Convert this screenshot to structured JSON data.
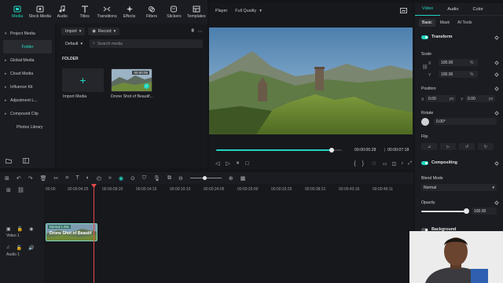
{
  "toolbar": {
    "items": [
      {
        "label": "Media",
        "icon": "media-icon"
      },
      {
        "label": "Stock Media",
        "icon": "cloud-icon"
      },
      {
        "label": "Audio",
        "icon": "music-icon"
      },
      {
        "label": "Titles",
        "icon": "text-icon"
      },
      {
        "label": "Transitions",
        "icon": "transition-icon"
      },
      {
        "label": "Effects",
        "icon": "sparkle-icon"
      },
      {
        "label": "Filters",
        "icon": "filter-icon"
      },
      {
        "label": "Stickers",
        "icon": "sticker-icon"
      },
      {
        "label": "Templates",
        "icon": "template-icon"
      }
    ],
    "active_color": "#1fd6c1"
  },
  "sidebar": {
    "items": [
      {
        "label": "Project Media"
      },
      {
        "label": "Folder"
      },
      {
        "label": "Global Media"
      },
      {
        "label": "Cloud Media"
      },
      {
        "label": "Influence Kit"
      },
      {
        "label": "Adjustment L..."
      },
      {
        "label": "Compound Clip"
      },
      {
        "label": "Photos Library"
      }
    ]
  },
  "media": {
    "import_label": "Import",
    "record_label": "Record",
    "sort_label": "Default",
    "search_placeholder": "Search media",
    "folder_heading": "FOLDER",
    "import_tile_label": "Import Media",
    "clip_label": "Drone Shot of Beautif...",
    "clip_duration": "00:00:05"
  },
  "player": {
    "label": "Player",
    "quality": "Full Quality",
    "current_time": "00:00:06:28",
    "total_time": "00:00:07:18",
    "progress": 0.92
  },
  "right_panel": {
    "tabs": [
      "Video",
      "Audio",
      "Color"
    ],
    "subtabs": [
      "Basic",
      "Mask",
      "AI Tools"
    ],
    "transform_label": "Transform",
    "scale_label": "Scale",
    "scale_x_label": "X",
    "scale_x": "100.00",
    "scale_y_label": "Y",
    "scale_y": "100.00",
    "percent_unit": "%",
    "position_label": "Position",
    "pos_x_label": "X",
    "pos_x": "0.00",
    "pos_y_label": "Y",
    "pos_y": "0.00",
    "px_unit": "px",
    "rotate_label": "Rotate",
    "rotate_value": "0.00°",
    "flip_label": "Flip",
    "compositing_label": "Compositing",
    "blend_label": "Blend Mode",
    "blend_value": "Normal",
    "opacity_label": "Opacity",
    "opacity_value": "100.00",
    "background_label": "Background"
  },
  "timeline": {
    "ruler": [
      "00:00",
      "00:00:04:25",
      "00:00:09:20",
      "00:00:14:15",
      "00:00:19:10",
      "00:00:24:05",
      "00:00:29:00",
      "00:00:33:25",
      "00:00:38:21",
      "00:00:43:16",
      "00:00:48:11"
    ],
    "clip_badge": "Normal 1.00x",
    "clip_name": "Drone Shot of Beautif",
    "video_track": "Video 1",
    "audio_track": "Audio 1"
  }
}
